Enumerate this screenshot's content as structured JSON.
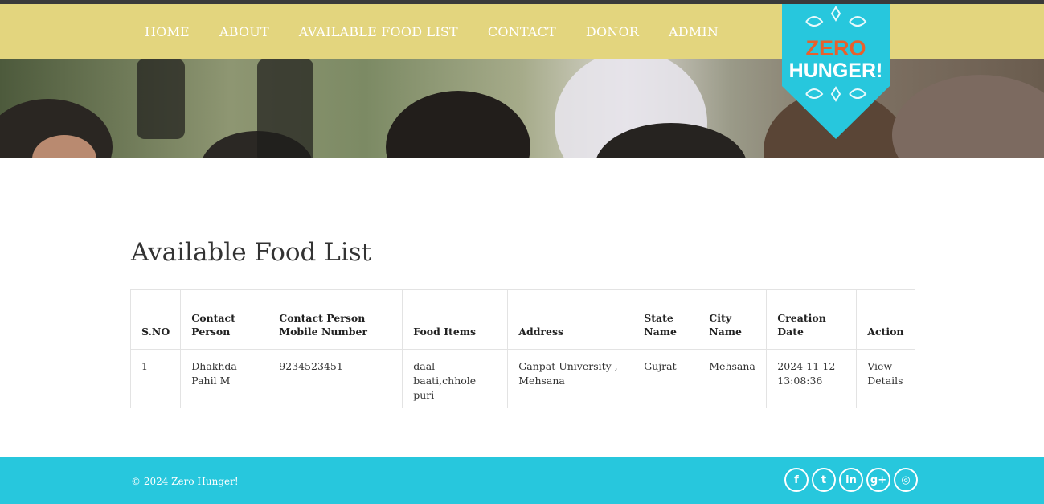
{
  "nav": {
    "items": [
      {
        "label": "HOME"
      },
      {
        "label": "ABOUT"
      },
      {
        "label": "AVAILABLE FOOD LIST"
      },
      {
        "label": "CONTACT"
      },
      {
        "label": "DONOR"
      },
      {
        "label": "ADMIN"
      }
    ]
  },
  "logo": {
    "line1": "ZERO",
    "line2": "HUNGER!",
    "color": "#27c7dd",
    "accent": "#e8602c"
  },
  "page": {
    "title": "Available Food List"
  },
  "table": {
    "headers": {
      "sno": "S.NO",
      "contact_person": "Contact Person",
      "mobile": "Contact Person Mobile Number",
      "food_items": "Food Items",
      "address": "Address",
      "state": "State Name",
      "city": "City Name",
      "date": "Creation Date",
      "action": "Action"
    },
    "rows": [
      {
        "sno": "1",
        "contact_person": "Dhakhda Pahil M",
        "mobile": "9234523451",
        "food_items": "daal baati,chhole puri",
        "address": "Ganpat University , Mehsana",
        "state": "Gujrat",
        "city": "Mehsana",
        "date": "2024-11-12 13:08:36",
        "action": "View Details"
      }
    ]
  },
  "footer": {
    "copyright": "© 2024 Zero Hunger!",
    "social": [
      {
        "icon": "facebook-icon",
        "glyph": "f"
      },
      {
        "icon": "twitter-icon",
        "glyph": "t"
      },
      {
        "icon": "linkedin-icon",
        "glyph": "in"
      },
      {
        "icon": "google-plus-icon",
        "glyph": "g+"
      },
      {
        "icon": "dribbble-icon",
        "glyph": "◎"
      }
    ],
    "color": "#27c7dd"
  },
  "colors": {
    "navbar": "#e3d57e",
    "footer": "#27c7dd"
  }
}
